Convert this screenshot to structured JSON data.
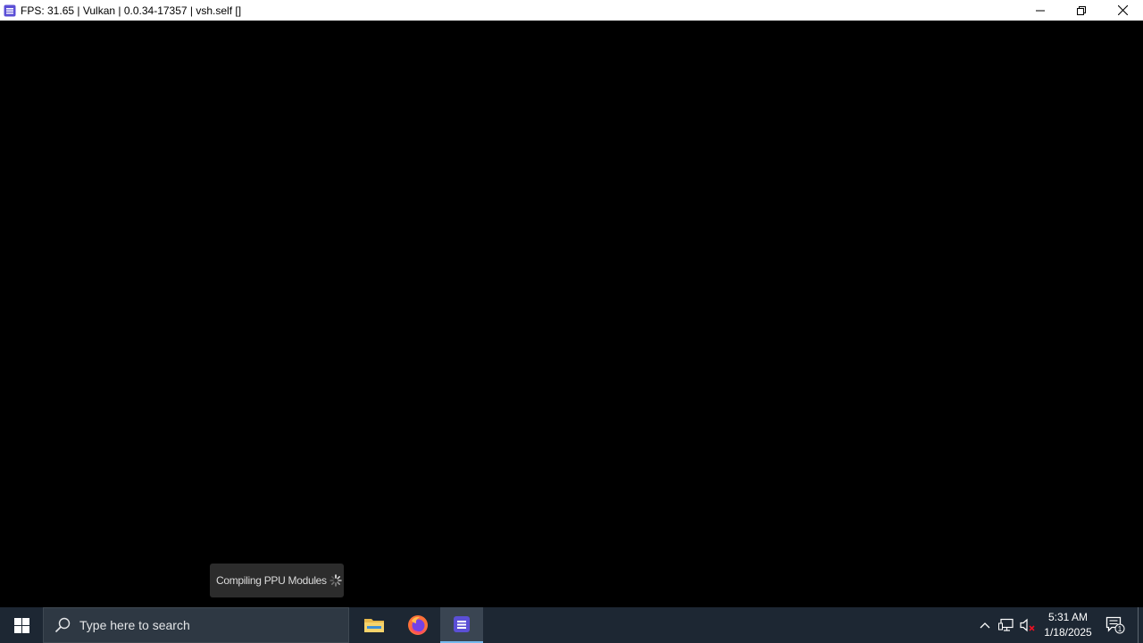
{
  "window": {
    "title": "FPS: 31.65 | Vulkan | 0.0.34-17357 | vsh.self []",
    "app_icon": "rpcs3-icon",
    "controls": [
      "minimize-icon",
      "restore-icon",
      "close-icon"
    ]
  },
  "overlay": {
    "toast_text": "Compiling PPU Modules",
    "spinner_icon": "loading-spinner-icon"
  },
  "taskbar": {
    "start_icon": "windows-start-icon",
    "search_placeholder": "Type here to search",
    "apps": [
      {
        "name": "File Explorer",
        "icon": "folder-icon",
        "active": false
      },
      {
        "name": "Firefox",
        "icon": "firefox-icon",
        "active": false
      },
      {
        "name": "RPCS3",
        "icon": "rpcs3-icon",
        "active": true
      }
    ],
    "tray_icons": [
      "chevron-up-icon",
      "network-icon",
      "volume-muted-icon"
    ],
    "clock": {
      "time": "5:31 AM",
      "date": "1/18/2025"
    },
    "notification_count": "1"
  },
  "colors": {
    "taskbar_bg": "#1d2733",
    "accent": "#76b9ed",
    "rpcs3_purple": "#5b4fd6"
  }
}
